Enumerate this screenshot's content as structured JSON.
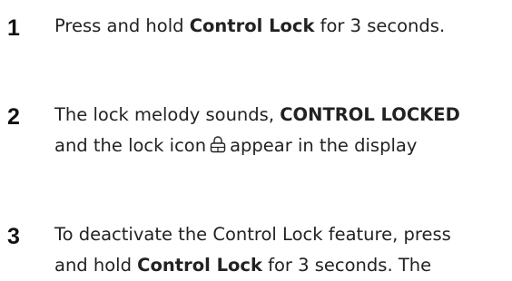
{
  "steps": [
    {
      "number": "1",
      "line1_pre": "Press and hold ",
      "line1_bold": "Control Lock",
      "line1_post": " for 3 seconds."
    },
    {
      "number": "2",
      "line1_pre": "The lock melody sounds, ",
      "line1_bold": "CONTROL LOCKED",
      "line2_pre": "and the lock icon",
      "line2_post": "appear in the display",
      "icon": "lock-icon"
    },
    {
      "number": "3",
      "line1": "To deactivate the Control Lock feature, press",
      "line2_pre": "and hold ",
      "line2_bold": "Control Lock",
      "line2_post": " for 3 seconds. The"
    }
  ]
}
